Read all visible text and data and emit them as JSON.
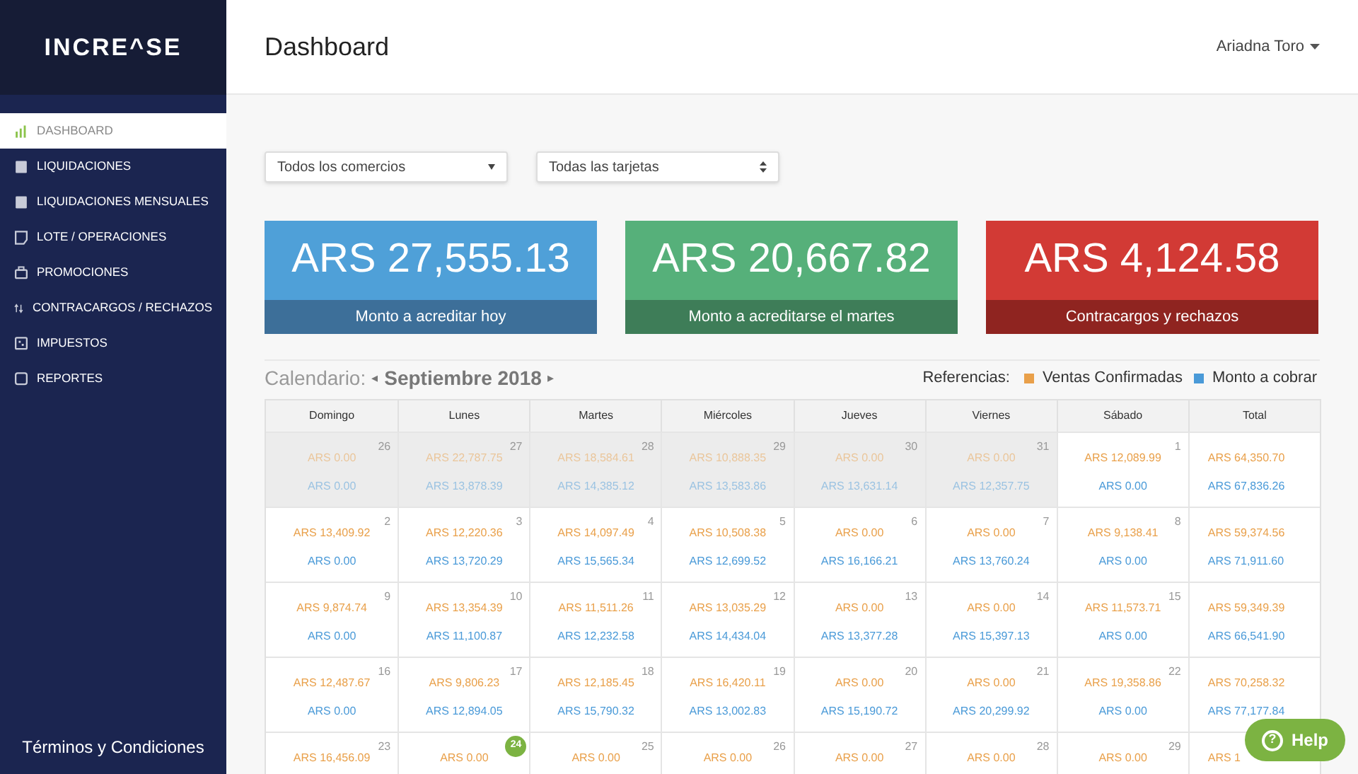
{
  "sidebar": {
    "logo": "INCRE^SE",
    "items": [
      {
        "label": "DASHBOARD",
        "kind": "chart",
        "selected": true
      },
      {
        "label": "LIQUIDACIONES",
        "kind": "calc",
        "selected": false
      },
      {
        "label": "LIQUIDACIONES MENSUALES",
        "kind": "calc",
        "selected": false
      },
      {
        "label": "LOTE / OPERACIONES",
        "kind": "doc",
        "selected": false
      },
      {
        "label": "PROMOCIONES",
        "kind": "bag",
        "selected": false
      },
      {
        "label": "CONTRACARGOS / RECHAZOS",
        "kind": "arrows",
        "selected": false
      },
      {
        "label": "IMPUESTOS",
        "kind": "grid",
        "selected": false
      },
      {
        "label": "REPORTES",
        "kind": "square",
        "selected": false
      }
    ],
    "footer": "Términos y Condiciones"
  },
  "header": {
    "title": "Dashboard",
    "user": "Ariadna Toro"
  },
  "filters": [
    {
      "value": "Todos los comercios",
      "kind": "dropdown"
    },
    {
      "value": "Todas las tarjetas",
      "kind": "stepper"
    }
  ],
  "cards": [
    {
      "amount": "ARS 27,555.13",
      "label": "Monto a acreditar hoy",
      "color": "#4fa0d8"
    },
    {
      "amount": "ARS 20,667.82",
      "label": "Monto a acreditarse el martes",
      "color": "#56b07a"
    },
    {
      "amount": "ARS 4,124.58",
      "label": "Contracargos y rechazos",
      "color": "#d23a35"
    }
  ],
  "calendar": {
    "label": "Calendario:",
    "month": "Septiembre 2018",
    "prev": "◂",
    "next": "▸",
    "legend_label": "Referencias:",
    "legend": [
      {
        "label": "Ventas Confirmadas",
        "color": "#e9a04a"
      },
      {
        "label": "Monto a cobrar",
        "color": "#4a9ad8"
      }
    ],
    "columns": [
      "Domingo",
      "Lunes",
      "Martes",
      "Miércoles",
      "Jueves",
      "Viernes",
      "Sábado",
      "Total"
    ],
    "rows": [
      {
        "cells": [
          {
            "day": "26",
            "sales": "ARS 0.00",
            "pay": "ARS 0.00",
            "muted": true,
            "today": false
          },
          {
            "day": "27",
            "sales": "ARS 22,787.75",
            "pay": "ARS 13,878.39",
            "muted": true,
            "today": false
          },
          {
            "day": "28",
            "sales": "ARS 18,584.61",
            "pay": "ARS 14,385.12",
            "muted": true,
            "today": false
          },
          {
            "day": "29",
            "sales": "ARS 10,888.35",
            "pay": "ARS 13,583.86",
            "muted": true,
            "today": false
          },
          {
            "day": "30",
            "sales": "ARS 0.00",
            "pay": "ARS 13,631.14",
            "muted": true,
            "today": false
          },
          {
            "day": "31",
            "sales": "ARS 0.00",
            "pay": "ARS 12,357.75",
            "muted": true,
            "today": false
          },
          {
            "day": "1",
            "sales": "ARS 12,089.99",
            "pay": "ARS 0.00",
            "muted": false,
            "today": false
          }
        ],
        "total": {
          "sales": "ARS 64,350.70",
          "pay": "ARS 67,836.26"
        }
      },
      {
        "cells": [
          {
            "day": "2",
            "sales": "ARS 13,409.92",
            "pay": "ARS 0.00",
            "muted": false,
            "today": false
          },
          {
            "day": "3",
            "sales": "ARS 12,220.36",
            "pay": "ARS 13,720.29",
            "muted": false,
            "today": false
          },
          {
            "day": "4",
            "sales": "ARS 14,097.49",
            "pay": "ARS 15,565.34",
            "muted": false,
            "today": false
          },
          {
            "day": "5",
            "sales": "ARS 10,508.38",
            "pay": "ARS 12,699.52",
            "muted": false,
            "today": false
          },
          {
            "day": "6",
            "sales": "ARS 0.00",
            "pay": "ARS 16,166.21",
            "muted": false,
            "today": false
          },
          {
            "day": "7",
            "sales": "ARS 0.00",
            "pay": "ARS 13,760.24",
            "muted": false,
            "today": false
          },
          {
            "day": "8",
            "sales": "ARS 9,138.41",
            "pay": "ARS 0.00",
            "muted": false,
            "today": false
          }
        ],
        "total": {
          "sales": "ARS 59,374.56",
          "pay": "ARS 71,911.60"
        }
      },
      {
        "cells": [
          {
            "day": "9",
            "sales": "ARS 9,874.74",
            "pay": "ARS 0.00",
            "muted": false,
            "today": false
          },
          {
            "day": "10",
            "sales": "ARS 13,354.39",
            "pay": "ARS 11,100.87",
            "muted": false,
            "today": false
          },
          {
            "day": "11",
            "sales": "ARS 11,511.26",
            "pay": "ARS 12,232.58",
            "muted": false,
            "today": false
          },
          {
            "day": "12",
            "sales": "ARS 13,035.29",
            "pay": "ARS 14,434.04",
            "muted": false,
            "today": false
          },
          {
            "day": "13",
            "sales": "ARS 0.00",
            "pay": "ARS 13,377.28",
            "muted": false,
            "today": false
          },
          {
            "day": "14",
            "sales": "ARS 0.00",
            "pay": "ARS 15,397.13",
            "muted": false,
            "today": false
          },
          {
            "day": "15",
            "sales": "ARS 11,573.71",
            "pay": "ARS 0.00",
            "muted": false,
            "today": false
          }
        ],
        "total": {
          "sales": "ARS 59,349.39",
          "pay": "ARS 66,541.90"
        }
      },
      {
        "cells": [
          {
            "day": "16",
            "sales": "ARS 12,487.67",
            "pay": "ARS 0.00",
            "muted": false,
            "today": false
          },
          {
            "day": "17",
            "sales": "ARS 9,806.23",
            "pay": "ARS 12,894.05",
            "muted": false,
            "today": false
          },
          {
            "day": "18",
            "sales": "ARS 12,185.45",
            "pay": "ARS 15,790.32",
            "muted": false,
            "today": false
          },
          {
            "day": "19",
            "sales": "ARS 16,420.11",
            "pay": "ARS 13,002.83",
            "muted": false,
            "today": false
          },
          {
            "day": "20",
            "sales": "ARS 0.00",
            "pay": "ARS 15,190.72",
            "muted": false,
            "today": false
          },
          {
            "day": "21",
            "sales": "ARS 0.00",
            "pay": "ARS 20,299.92",
            "muted": false,
            "today": false
          },
          {
            "day": "22",
            "sales": "ARS 19,358.86",
            "pay": "ARS 0.00",
            "muted": false,
            "today": false
          }
        ],
        "total": {
          "sales": "ARS 70,258.32",
          "pay": "ARS 77,177.84"
        }
      },
      {
        "cells": [
          {
            "day": "23",
            "sales": "ARS 16,456.09",
            "muted": false,
            "today": false
          },
          {
            "day": "24",
            "sales": "ARS 0.00",
            "muted": false,
            "today": true
          },
          {
            "day": "25",
            "sales": "ARS 0.00",
            "muted": false,
            "today": false
          },
          {
            "day": "26",
            "sales": "ARS 0.00",
            "muted": false,
            "today": false
          },
          {
            "day": "27",
            "sales": "ARS 0.00",
            "muted": false,
            "today": false
          },
          {
            "day": "28",
            "sales": "ARS 0.00",
            "muted": false,
            "today": false
          },
          {
            "day": "29",
            "sales": "ARS 0.00",
            "muted": false,
            "today": false
          }
        ],
        "total": {
          "sales": "ARS 1"
        }
      }
    ]
  },
  "help": {
    "label": "Help",
    "icon": "?"
  }
}
